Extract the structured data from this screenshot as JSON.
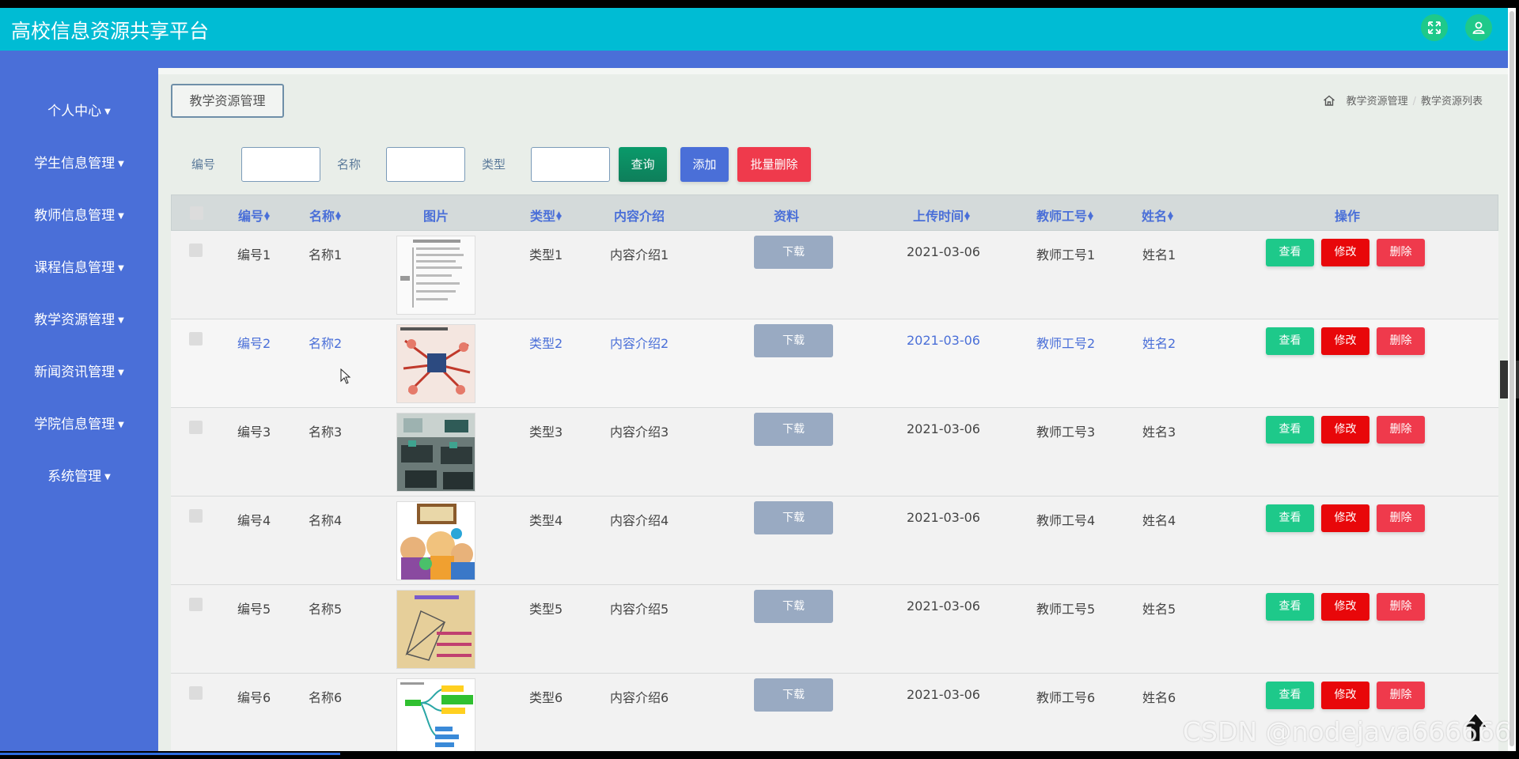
{
  "header": {
    "title": "高校信息资源共享平台",
    "bg_color": "#00bcd4",
    "expand_icon": "fullscreen-icon",
    "user_icon": "user-icon"
  },
  "sidebar": {
    "bg_color": "#4a6fd8",
    "items": [
      {
        "label": "个人中心"
      },
      {
        "label": "学生信息管理"
      },
      {
        "label": "教师信息管理"
      },
      {
        "label": "课程信息管理"
      },
      {
        "label": "教学资源管理"
      },
      {
        "label": "新闻资讯管理"
      },
      {
        "label": "学院信息管理"
      },
      {
        "label": "系统管理"
      }
    ]
  },
  "page": {
    "tag": "教学资源管理",
    "breadcrumb": [
      "教学资源管理",
      "教学资源列表"
    ]
  },
  "search": {
    "fields": [
      {
        "label": "编号",
        "value": ""
      },
      {
        "label": "名称",
        "value": ""
      },
      {
        "label": "类型",
        "value": ""
      }
    ],
    "query_label": "查询",
    "add_label": "添加",
    "batch_delete_label": "批量删除"
  },
  "table": {
    "columns": [
      "编号",
      "名称",
      "图片",
      "类型",
      "内容介绍",
      "资料",
      "上传时间",
      "教师工号",
      "姓名",
      "操作"
    ],
    "download_label": "下载",
    "view_label": "查看",
    "edit_label": "修改",
    "delete_label": "删除",
    "rows": [
      {
        "id": "编号1",
        "name": "名称1",
        "type": "类型1",
        "intro": "内容介绍1",
        "time": "2021-03-06",
        "teacher_no": "教师工号1",
        "tname": "姓名1"
      },
      {
        "id": "编号2",
        "name": "名称2",
        "type": "类型2",
        "intro": "内容介绍2",
        "time": "2021-03-06",
        "teacher_no": "教师工号2",
        "tname": "姓名2"
      },
      {
        "id": "编号3",
        "name": "名称3",
        "type": "类型3",
        "intro": "内容介绍3",
        "time": "2021-03-06",
        "teacher_no": "教师工号3",
        "tname": "姓名3"
      },
      {
        "id": "编号4",
        "name": "名称4",
        "type": "类型4",
        "intro": "内容介绍4",
        "time": "2021-03-06",
        "teacher_no": "教师工号4",
        "tname": "姓名4"
      },
      {
        "id": "编号5",
        "name": "名称5",
        "type": "类型5",
        "intro": "内容介绍5",
        "time": "2021-03-06",
        "teacher_no": "教师工号5",
        "tname": "姓名5"
      },
      {
        "id": "编号6",
        "name": "名称6",
        "type": "类型6",
        "intro": "内容介绍6",
        "time": "2021-03-06",
        "teacher_no": "教师工号6",
        "tname": "姓名6"
      }
    ]
  },
  "watermark": "CSDN @nodejava666666"
}
